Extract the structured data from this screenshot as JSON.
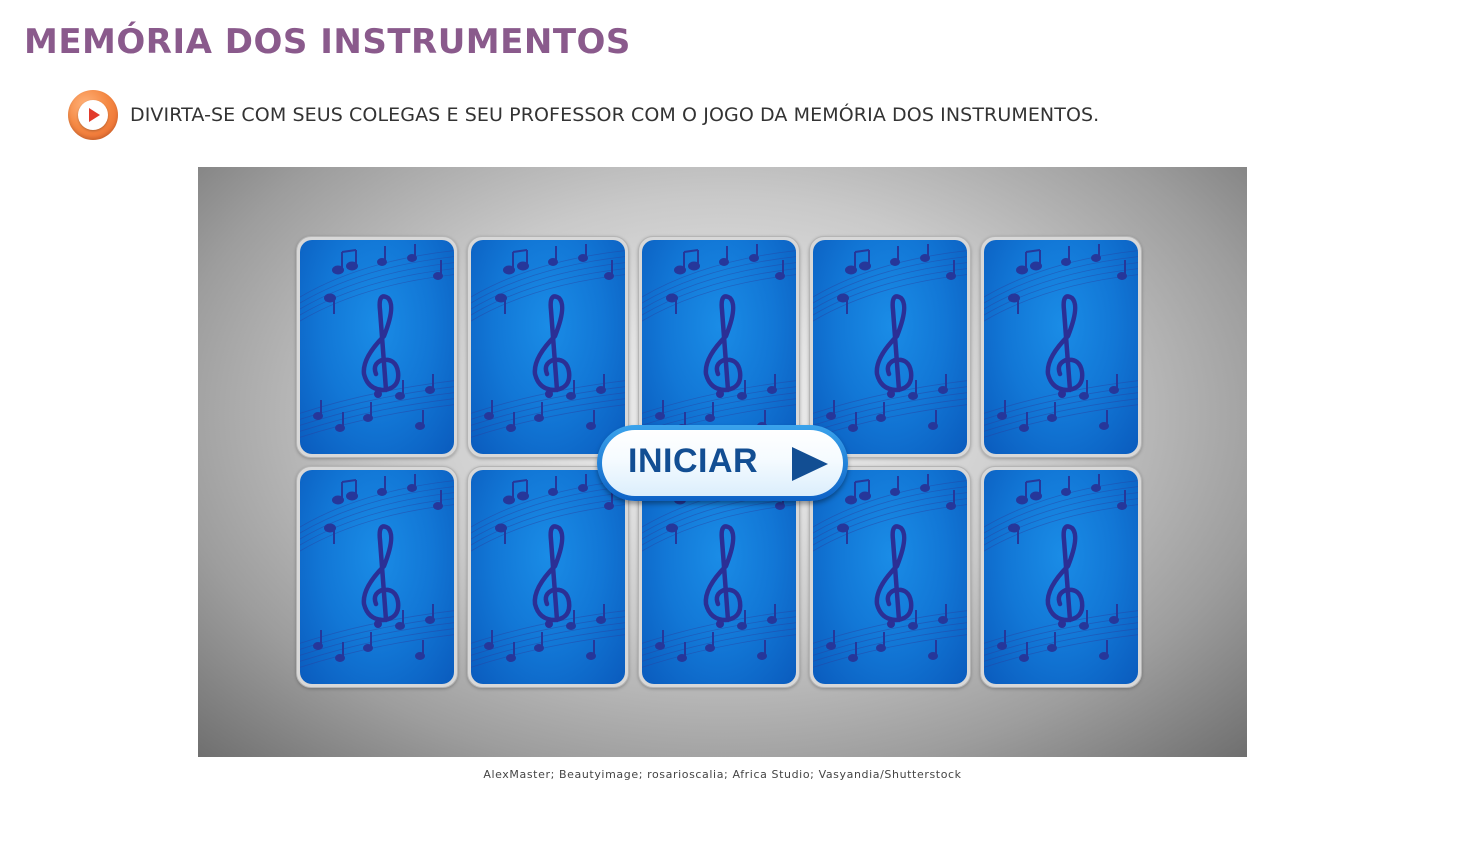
{
  "page": {
    "title": "MEMÓRIA DOS INSTRUMENTOS",
    "title_color": "#8a5a8c"
  },
  "instruction": {
    "audio_icon": "play-audio-icon",
    "text": "DIVIRTA-SE COM SEUS COLEGAS E SEU PROFESSOR COM O JOGO DA MEMÓRIA DOS INSTRUMENTOS."
  },
  "game": {
    "card_back_icon": "treble-clef-music-notes",
    "card_rows": 2,
    "card_columns": 5,
    "start_button_label": "INICIAR",
    "start_button_icon": "play-arrow-icon",
    "accent_color": "#1277d6"
  },
  "credits": "AlexMaster; Beautyimage; rosarioscalia; Africa Studio; Vasyandia/Shutterstock"
}
